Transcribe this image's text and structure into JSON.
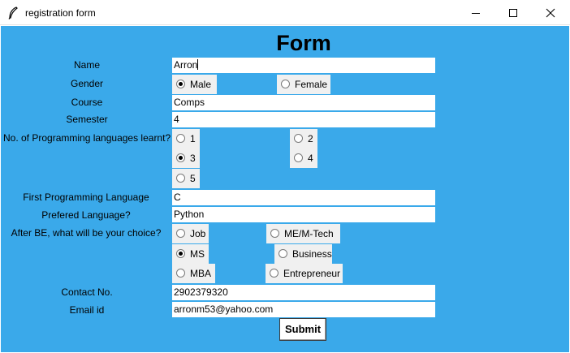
{
  "window": {
    "title": "registration form"
  },
  "form": {
    "heading": "Form",
    "labels": {
      "name": "Name",
      "gender": "Gender",
      "course": "Course",
      "semester": "Semester",
      "languages_count": "No. of Programming languages learnt?",
      "first_language": "First Programming Language",
      "preferred_language": "Prefered Language?",
      "after_be": "After BE, what will be your choice?",
      "contact": "Contact No.",
      "email": "Email id"
    },
    "values": {
      "name": "Arron",
      "course": "Comps",
      "semester": "4",
      "first_language": "C",
      "preferred_language": "Python",
      "contact": "2902379320",
      "email": "arronm53@yahoo.com"
    },
    "gender_options": [
      "Male",
      "Female"
    ],
    "gender_selected": "Male",
    "languages_count_options": [
      "1",
      "2",
      "3",
      "4",
      "5"
    ],
    "languages_count_selected": "3",
    "after_be_options": [
      "Job",
      "ME/M-Tech",
      "MS",
      "Business",
      "MBA",
      "Entrepreneur"
    ],
    "after_be_selected": "MS",
    "submit_label": "Submit"
  }
}
